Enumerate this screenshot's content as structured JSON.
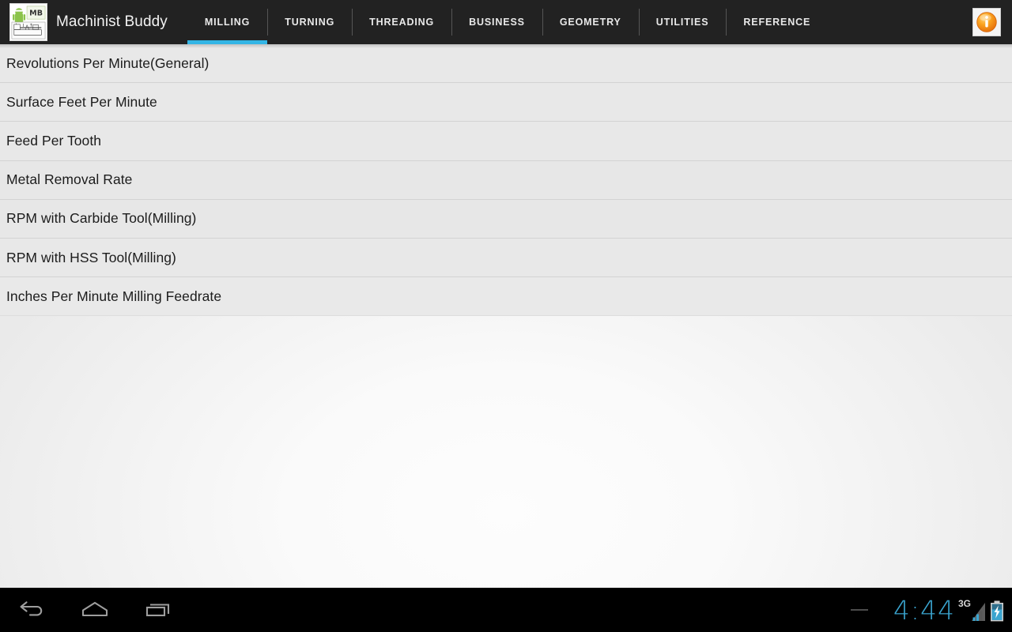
{
  "app": {
    "title": "Machinist Buddy",
    "icon_name": "machinist-buddy-app-icon"
  },
  "actionbar": {
    "info_button": {
      "icon": "info-icon",
      "label": "Info",
      "color": "#f08a1e"
    },
    "tabs": [
      {
        "label": "MILLING",
        "active": true
      },
      {
        "label": "TURNING",
        "active": false
      },
      {
        "label": "THREADING",
        "active": false
      },
      {
        "label": "BUSINESS",
        "active": false
      },
      {
        "label": "GEOMETRY",
        "active": false
      },
      {
        "label": "UTILITIES",
        "active": false
      },
      {
        "label": "REFERENCE",
        "active": false
      }
    ],
    "active_tab_color": "#33b5e5",
    "background_color": "#222222"
  },
  "main": {
    "list_items": [
      {
        "label": "Revolutions Per Minute(General)"
      },
      {
        "label": "Surface Feet Per Minute"
      },
      {
        "label": "Feed Per Tooth"
      },
      {
        "label": "Metal Removal Rate"
      },
      {
        "label": "RPM with Carbide Tool(Milling)"
      },
      {
        "label": "RPM with HSS Tool(Milling)"
      },
      {
        "label": "Inches Per Minute Milling Feedrate"
      }
    ]
  },
  "navbar": {
    "buttons": [
      {
        "name": "back",
        "icon": "back-arrow-icon"
      },
      {
        "name": "home",
        "icon": "home-icon"
      },
      {
        "name": "recents",
        "icon": "recent-apps-icon"
      }
    ],
    "status": {
      "clock": "4:44",
      "network_type": "3G",
      "signal_icon": "signal-bars-icon",
      "battery_icon": "battery-charging-icon",
      "clock_color": "#3aa5d0"
    }
  }
}
